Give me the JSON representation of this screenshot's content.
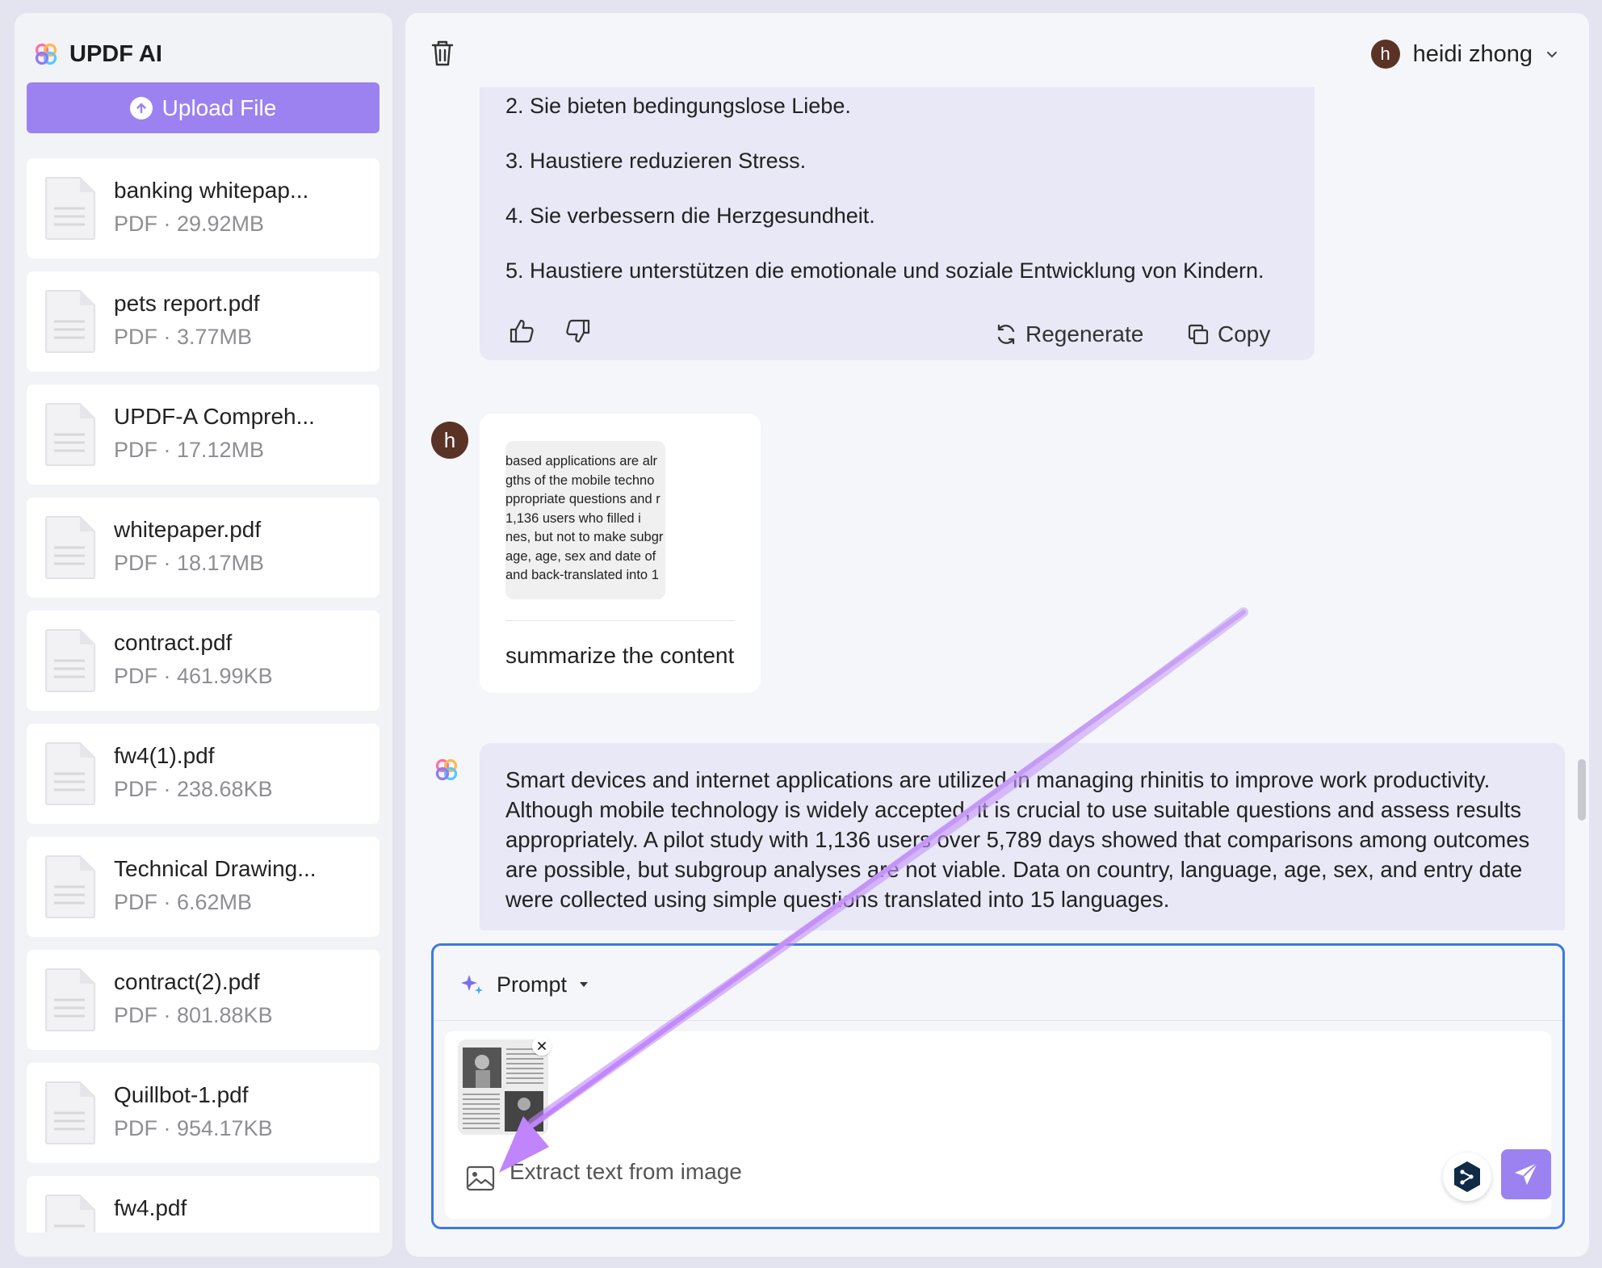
{
  "sidebar": {
    "brand": "UPDF AI",
    "upload_label": "Upload File",
    "files": [
      {
        "name": "banking whitepap...",
        "meta": "PDF · 29.92MB"
      },
      {
        "name": "pets report.pdf",
        "meta": "PDF · 3.77MB"
      },
      {
        "name": "UPDF-A Compreh...",
        "meta": "PDF · 17.12MB"
      },
      {
        "name": "whitepaper.pdf",
        "meta": "PDF · 18.17MB"
      },
      {
        "name": "contract.pdf",
        "meta": "PDF · 461.99KB"
      },
      {
        "name": "fw4(1).pdf",
        "meta": "PDF · 238.68KB"
      },
      {
        "name": "Technical Drawing...",
        "meta": "PDF · 6.62MB"
      },
      {
        "name": "contract(2).pdf",
        "meta": "PDF · 801.88KB"
      },
      {
        "name": "Quillbot-1.pdf",
        "meta": "PDF · 954.17KB"
      },
      {
        "name": "fw4.pdf",
        "meta": ""
      }
    ]
  },
  "header": {
    "user_initial": "h",
    "user_name": "heidi zhong"
  },
  "chat": {
    "ai_message_1": {
      "items": [
        "2.  Sie bieten bedingungslose Liebe.",
        "3.  Haustiere reduzieren Stress.",
        "4.  Sie verbessern die Herzgesundheit.",
        "5.  Haustiere unterstützen die emotionale und soziale Entwicklung von Kindern."
      ],
      "regenerate_label": "Regenerate",
      "copy_label": "Copy"
    },
    "user_message": {
      "avatar_initial": "h",
      "image_text_lines": [
        "based applications are alr",
        "gths of the mobile techno",
        "ppropriate questions and r",
        " 1,136  users  who  filled  i",
        "nes, but not to make subgr",
        "age, age, sex and date of",
        " and back-translated into 1"
      ],
      "text": "summarize the content"
    },
    "ai_message_2": {
      "lines": [
        "Smart devices and internet applications are utilized in managing rhinitis to improve work productivity.",
        "Although mobile technology is widely accepted, it is crucial to use suitable questions and assess results",
        "appropriately. A pilot study with 1,136 users over 5,789 days showed that comparisons among outcomes",
        "are possible, but subgroup analyses are not viable. Data on country, language, age, sex, and entry date",
        "were collected using simple questions translated into 15 languages."
      ]
    }
  },
  "composer": {
    "prompt_label": "Prompt",
    "input_value": "Extract text from image"
  },
  "colors": {
    "accent": "#9b82f0",
    "focus_border": "#3b7ae0",
    "ai_bubble": "#e8e8f7",
    "annotation_arrow": "#c084fc"
  }
}
